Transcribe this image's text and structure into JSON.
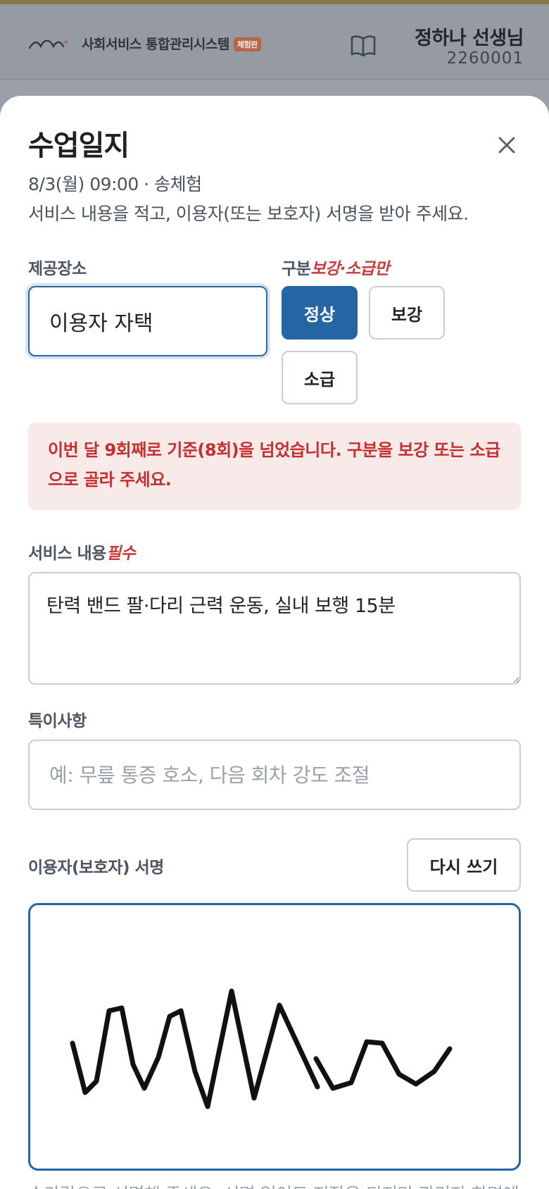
{
  "app": {
    "title": "사회서비스 통합관리시스템",
    "badge": "체험판",
    "user_name": "정하나 선생님",
    "user_id": "2260001"
  },
  "modal": {
    "title": "수업일지",
    "meta": "8/3(월) 09:00 · 송체험",
    "description": "서비스 내용을 적고, 이용자(또는 보호자) 서명을 받아 주세요.",
    "place": {
      "label": "제공장소",
      "value": "이용자 자택"
    },
    "category": {
      "label": "구분",
      "hint": "보강·소급만",
      "options": [
        "정상",
        "보강",
        "소급"
      ],
      "selected": "정상"
    },
    "alert": "이번 달 9회째로 기준(8회)을 넘었습니다. 구분을 보강 또는 소급으로 골라 주세요.",
    "service": {
      "label": "서비스 내용",
      "required": "필수",
      "value": "탄력 밴드 팔·다리 근력 운동, 실내 보행 15분"
    },
    "notes": {
      "label": "특이사항",
      "placeholder": "예: 무릎 통증 호소, 다음 회차 강도 조절"
    },
    "signature": {
      "label": "이용자(보호자) 서명",
      "rewrite_label": "다시 쓰기",
      "footnote": "손가락으로 서명해 주세요. 서명 없이도 저장은 되지만 관리자 화면에"
    }
  },
  "colors": {
    "primary": "#2466a4",
    "danger": "#c62f2f",
    "danger_bg": "#f9eaea",
    "border": "#c9ced6"
  }
}
